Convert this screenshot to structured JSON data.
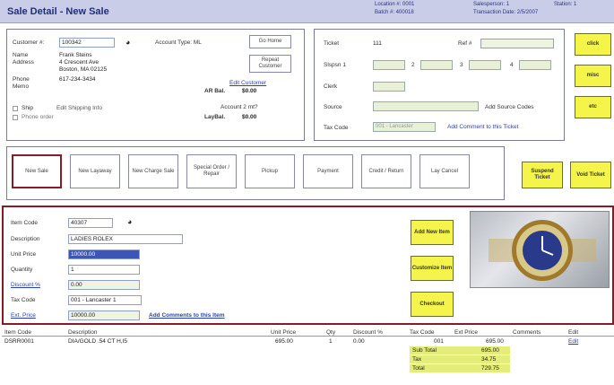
{
  "header": {
    "title": "Sale Detail - New Sale",
    "location": "Location #: 0001",
    "batch": "Batch #: 400018",
    "employee": "Salesperson: 1",
    "station": "Station: 1",
    "date": "Transaction Date: 2/5/2007"
  },
  "customer": {
    "number_label": "Customer #:",
    "number": "100342",
    "account_type": "Account Type: ML",
    "go_home": "Go Home",
    "name_label": "Name",
    "name": "Frank Steins",
    "address_label": "Address",
    "address1": "4 Crescent Ave",
    "address2": "Boston, MA 02125",
    "phone_label": "Phone",
    "phone": "617-234-3434",
    "memo_label": "Memo",
    "repeat_customer": "Repeat Customer",
    "edit_customer": "Edit Customer",
    "ar_bal_label": "AR Bal.",
    "ar_bal": "$0.00",
    "account_2_label": "Account 2 mt?",
    "layaway_label": "LayBal.",
    "layaway_bal": "$0.00",
    "ship_label": "Ship",
    "phone_order_label": "Phone order",
    "edit_shipping": "Edit Shipping Info"
  },
  "ticket": {
    "ticket_label": "Ticket",
    "ticket": "111",
    "ref_label": "Ref #",
    "slspn1_label": "Slspsn 1",
    "slspn_values": [
      "2",
      "3",
      "4"
    ],
    "clerk_label": "Clerk",
    "source_label": "Source",
    "add_source": "Add Source Codes",
    "tax_label": "Tax Code",
    "tax_value": "001 - Lancaster",
    "add_comment": "Add Comment to this Ticket"
  },
  "right_buttons": {
    "click": "click",
    "misc": "misc",
    "etc": "etc"
  },
  "actions": {
    "new_sale": "New Sale",
    "new_layaway": "New Layaway",
    "new_charge": "New Charge Sale",
    "special": "Special Order / Repair",
    "pickup": "Pickup",
    "payment": "Payment",
    "credit": "Credit / Return",
    "lay_cancel": "Lay Cancel"
  },
  "suspend": {
    "suspend_ticket": "Suspend Ticket",
    "void_ticket": "Void Ticket"
  },
  "item": {
    "code_label": "Item Code",
    "code": "40307",
    "desc_label": "Description",
    "desc": "LADIES ROLEX",
    "unit_label": "Unit Price",
    "unit": "10000.00",
    "qty_label": "Quantity",
    "qty": "1",
    "discount_label": "Discount %",
    "discount": "0.00",
    "tax_label": "Tax Code",
    "tax": "001 - Lancaster 1",
    "ext_label": "Ext. Price",
    "ext": "10000.00",
    "add_comment": "Add Comments to this Item",
    "add_new": "Add New Item",
    "customize": "Customize Item",
    "checkout": "Checkout"
  },
  "table": {
    "headers": [
      "Item Code",
      "Description",
      "Unit Price",
      "Qty",
      "Discount %",
      "Tax Code",
      "Ext Price",
      "Comments",
      "Edit"
    ],
    "rows": [
      {
        "code": "DSRR0001",
        "desc": "DIA/GOLD .54 CT H,I5",
        "unit": "695.00",
        "qty": "1",
        "disc": "0.00",
        "tax": "001",
        "ext": "695.00",
        "edit": "Edit"
      }
    ],
    "totals": [
      {
        "label": "Sub Total",
        "value": "695.00"
      },
      {
        "label": "Tax",
        "value": "34.75"
      },
      {
        "label": "Total",
        "value": "729.75"
      }
    ]
  }
}
